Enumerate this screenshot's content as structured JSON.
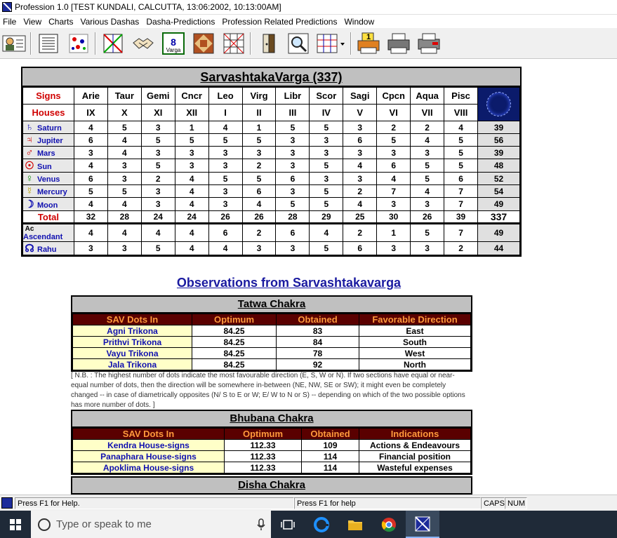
{
  "window": {
    "title": "Profession 1.0 [TEST KUNDALI, CALCUTTA, 13:06:2002, 10:13:00AM]"
  },
  "menu": [
    "File",
    "View",
    "Charts",
    "Various Dashas",
    "Dasha-Predictions",
    "Profession Related Predictions",
    "Window"
  ],
  "toolbar": {
    "icons": [
      "person-card-icon",
      "notebook-icon",
      "stars-chart-icon",
      "cross-chart-icon",
      "handshake-icon",
      "varga-8-icon",
      "mandala-icon",
      "grid-chart-icon",
      "exit-door-icon",
      "magnifier-icon",
      "table-dropdown-icon",
      "printer-preview-icon",
      "printer-icon",
      "printer-setup-icon"
    ],
    "varga_label": "Varga",
    "varga_num": "8",
    "print_num": "1"
  },
  "sav": {
    "title": "SarvashtakaVarga (337)",
    "signs_label": "Signs",
    "houses_label": "Houses",
    "signs": [
      "Arie",
      "Taur",
      "Gemi",
      "Cncr",
      "Leo",
      "Virg",
      "Libr",
      "Scor",
      "Sagi",
      "Cpcn",
      "Aqua",
      "Pisc"
    ],
    "houses": [
      "IX",
      "X",
      "XI",
      "XII",
      "I",
      "II",
      "III",
      "IV",
      "V",
      "VI",
      "VII",
      "VIII"
    ],
    "rows": [
      {
        "sym": "♄",
        "name": "Saturn",
        "color": "#1010b0",
        "vals": [
          "4",
          "5",
          "3",
          "1",
          "4",
          "1",
          "5",
          "5",
          "3",
          "2",
          "2",
          "4"
        ],
        "total": "39"
      },
      {
        "sym": "♃",
        "name": "Jupiter",
        "color": "#d00000",
        "vals": [
          "6",
          "4",
          "5",
          "5",
          "5",
          "5",
          "3",
          "3",
          "6",
          "5",
          "4",
          "5"
        ],
        "total": "56"
      },
      {
        "sym": "♂",
        "name": "Mars",
        "color": "#d00000",
        "vals": [
          "3",
          "4",
          "3",
          "3",
          "3",
          "3",
          "3",
          "3",
          "3",
          "3",
          "3",
          "5"
        ],
        "total": "39"
      },
      {
        "sym": "☉",
        "name": "Sun",
        "color": "#d00000",
        "vals": [
          "4",
          "3",
          "5",
          "3",
          "3",
          "2",
          "3",
          "5",
          "4",
          "6",
          "5",
          "5"
        ],
        "total": "48"
      },
      {
        "sym": "♀",
        "name": "Venus",
        "color": "#0a8a0a",
        "vals": [
          "6",
          "3",
          "2",
          "4",
          "5",
          "5",
          "6",
          "3",
          "3",
          "4",
          "5",
          "6"
        ],
        "total": "52"
      },
      {
        "sym": "☿",
        "name": "Mercury",
        "color": "#b8a000",
        "vals": [
          "5",
          "5",
          "3",
          "4",
          "3",
          "6",
          "3",
          "5",
          "2",
          "7",
          "4",
          "7"
        ],
        "total": "54"
      },
      {
        "sym": "☽",
        "name": "Moon",
        "color": "#1010b0",
        "vals": [
          "4",
          "4",
          "3",
          "4",
          "3",
          "4",
          "5",
          "5",
          "4",
          "3",
          "3",
          "7"
        ],
        "total": "49"
      }
    ],
    "total_label": "Total",
    "totals": [
      "32",
      "28",
      "24",
      "24",
      "26",
      "26",
      "28",
      "29",
      "25",
      "30",
      "26",
      "39"
    ],
    "grand_total": "337",
    "extra_rows": [
      {
        "sym": "Ac",
        "name": "Ascendant",
        "color": "#000000",
        "vals": [
          "4",
          "4",
          "4",
          "4",
          "6",
          "2",
          "6",
          "4",
          "2",
          "1",
          "5",
          "7"
        ],
        "total": "49"
      },
      {
        "sym": "☊",
        "name": "Rahu",
        "color": "#1010b0",
        "vals": [
          "3",
          "3",
          "5",
          "4",
          "4",
          "3",
          "3",
          "5",
          "6",
          "3",
          "3",
          "2"
        ],
        "total": "44"
      }
    ]
  },
  "observations_title": "Observations from Sarvashtakavarga",
  "tatwa": {
    "title": "Tatwa Chakra",
    "headers": [
      "SAV Dots In",
      "Optimum",
      "Obtained",
      "Favorable Direction"
    ],
    "rows": [
      [
        "Agni Trikona",
        "84.25",
        "83",
        "East"
      ],
      [
        "Prithvi Trikona",
        "84.25",
        "84",
        "South"
      ],
      [
        "Vayu Trikona",
        "84.25",
        "78",
        "West"
      ],
      [
        "Jala Trikona",
        "84.25",
        "92",
        "North"
      ]
    ]
  },
  "note": "[ N.B. : The highest number of dots indicate the most favourable direction (E, S, W or N). If two sections have equal or near-equal number of dots, then the direction will be somewhere in-between (NE, NW, SE or SW); it might even be completely changed -- in case of diametrically opposites (N/ S to E or W; E/ W to N or S) -- depending on which of the two possible options has more number of dots. ]",
  "bhubana": {
    "title": "Bhubana Chakra",
    "headers": [
      "SAV Dots In",
      "Optimum",
      "Obtained",
      "Indications"
    ],
    "rows": [
      [
        "Kendra House-signs",
        "112.33",
        "109",
        "Actions & Endeavours"
      ],
      [
        "Panaphara House-signs",
        "112.33",
        "114",
        "Financial position"
      ],
      [
        "Apoklima House-signs",
        "112.33",
        "114",
        "Wasteful expenses"
      ]
    ]
  },
  "disha": {
    "title": "Disha Chakra"
  },
  "status": {
    "left": "Press F1 for Help.",
    "mid": "Press F1 for help",
    "caps": "CAPS",
    "num": "NUM"
  },
  "taskbar": {
    "search_placeholder": "Type or speak to me"
  }
}
